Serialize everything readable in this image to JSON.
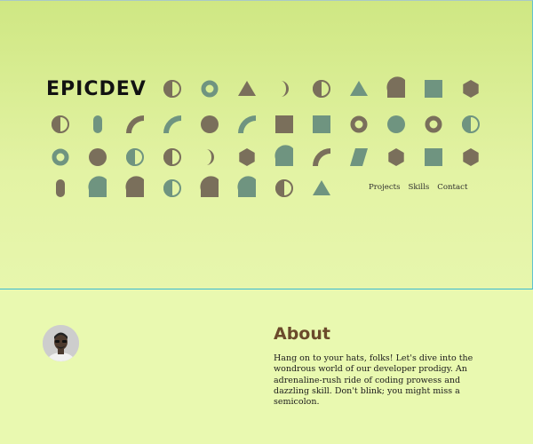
{
  "header": {
    "brand": "EPICDEV",
    "nav": [
      "Projects",
      "Skills",
      "Contact"
    ]
  },
  "about": {
    "title": "About",
    "text": "Hang on to your hats, folks! Let's dive into the wondrous world of our developer prodigy. An adrenaline-rush ride of coding prowess and dazzling skill. Don't blink; you might miss a semicolon."
  },
  "colors": {
    "shape_brown": "#7a6f5b",
    "shape_green": "#6f9480",
    "title_brown": "#6b4a2b",
    "divider_cyan": "#38b9d2"
  },
  "shapes": {
    "row1": [
      "half-circle",
      "ring",
      "triangle",
      "crescent",
      "half-circle",
      "triangle",
      "quarter-circle",
      "square",
      "hexagon"
    ],
    "row2": [
      "half-circle",
      "pill",
      "arc",
      "arc",
      "circle",
      "arc",
      "square",
      "square",
      "ring",
      "circle",
      "ring",
      "half-circle"
    ],
    "row3": [
      "ring",
      "circle",
      "half-circle",
      "half-circle",
      "crescent",
      "hexagon",
      "quarter-circle",
      "arc",
      "parallelogram",
      "hexagon",
      "square",
      "hexagon"
    ],
    "row4": [
      "pill",
      "quarter-circle",
      "quarter-circle",
      "half-circle",
      "quarter-circle",
      "quarter-circle",
      "half-circle",
      "triangle"
    ]
  }
}
